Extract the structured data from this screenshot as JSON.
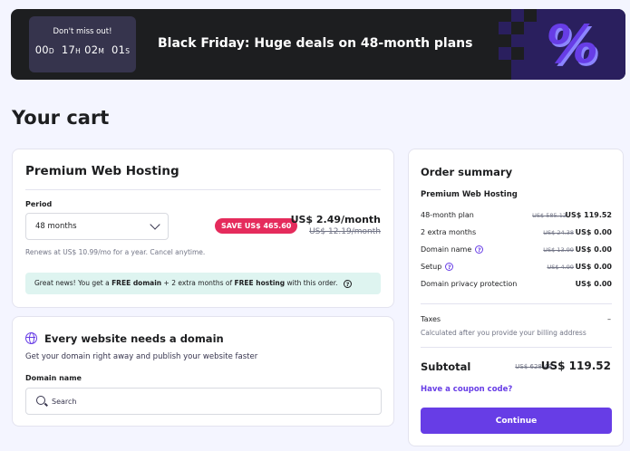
{
  "banner": {
    "countdown_label": "Don't miss out!",
    "days": "00",
    "days_unit": "D",
    "hours": "17",
    "hours_unit": "H",
    "minutes": "02",
    "minutes_unit": "M",
    "seconds": "01",
    "seconds_unit": "S",
    "title": "Black Friday: Huge deals on 48-month plans",
    "graphic_symbol": "%"
  },
  "page_title": "Your cart",
  "hosting": {
    "title": "Premium Web Hosting",
    "period_label": "Period",
    "period_value": "48 months",
    "save_badge": "SAVE US$ 465.60",
    "price": "US$ 2.49/month",
    "old_price": "US$ 12.19/month",
    "renews_note": "Renews at US$ 10.99/mo for a year. Cancel anytime.",
    "info_prefix": "Great news! You get a ",
    "info_free_domain": "FREE domain",
    "info_middle": " + 2 extra months of ",
    "info_free_hosting": "FREE hosting",
    "info_suffix": " with this order."
  },
  "domain": {
    "title": "Every website needs a domain",
    "subtitle": "Get your domain right away and publish your website faster",
    "field_label": "Domain name",
    "search_placeholder": "Search"
  },
  "summary": {
    "title": "Order summary",
    "plan_name": "Premium Web Hosting",
    "rows": [
      {
        "label": "48-month plan",
        "old": "US$ 585.12",
        "value": "US$ 119.52"
      },
      {
        "label": "2 extra months",
        "old": "US$ 24.38",
        "value": "US$ 0.00"
      },
      {
        "label": "Domain name",
        "old": "US$ 13.99",
        "value": "US$ 0.00"
      },
      {
        "label": "Setup",
        "old": "US$ 4.99",
        "value": "US$ 0.00"
      },
      {
        "label": "Domain privacy protection",
        "old": "",
        "value": "US$ 0.00"
      }
    ],
    "taxes_label": "Taxes",
    "taxes_value": "–",
    "taxes_note": "Calculated after you provide your billing address",
    "subtotal_label": "Subtotal",
    "subtotal_old": "US$ 628.48",
    "subtotal_value": "US$ 119.52",
    "coupon_link": "Have a coupon code?",
    "continue_label": "Continue"
  },
  "colors": {
    "accent": "#673de6",
    "badge": "#e52b5c",
    "info_bg": "#def4f0",
    "banner_bg": "#1d1e20"
  }
}
